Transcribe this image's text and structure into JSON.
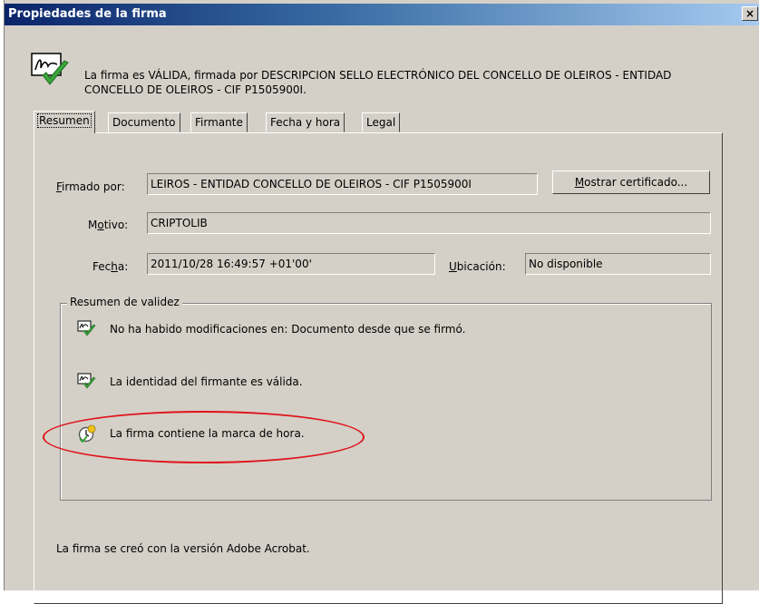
{
  "window": {
    "title": "Propiedades de la firma",
    "close_glyph": "×"
  },
  "status_message": "La firma es VÁLIDA, firmada por DESCRIPCION SELLO ELECTRÓNICO DEL CONCELLO DE OLEIROS - ENTIDAD CONCELLO DE OLEIROS - CIF P1505900I.",
  "tabs": [
    "Resumen",
    "Documento",
    "Firmante",
    "Fecha y hora",
    "Legal"
  ],
  "summary": {
    "signed_by_label_first": "F",
    "signed_by_label_rest": "irmado por:",
    "signed_by_value": "LEIROS - ENTIDAD CONCELLO DE OLEIROS - CIF P1505900I",
    "show_cert_first": "M",
    "show_cert_rest": "ostrar certificado...",
    "reason_label_a": "M",
    "reason_label_u": "o",
    "reason_label_b": "tivo:",
    "reason_value": "CRIPTOLIB",
    "date_label_a": "Fec",
    "date_label_u": "h",
    "date_label_b": "a:",
    "date_value": "2011/10/28 16:49:57 +01'00'",
    "location_label_u": "U",
    "location_label_b": "bicación:",
    "location_value": "No disponible"
  },
  "validity": {
    "title": "Resumen de validez",
    "items": [
      "No ha habido modificaciones en: Documento desde que se firmó.",
      "La identidad del firmante es válida.",
      "La firma contiene la marca de hora."
    ]
  },
  "footer_text": "La firma se creó con la versión Adobe Acrobat.",
  "colors": {
    "highlight": "#e0131a",
    "check": "#3aa53a",
    "title_bar": "#0a246a"
  },
  "icons": [
    "signature-valid-icon",
    "check-doc-icon",
    "timestamp-clock-icon",
    "close-icon"
  ]
}
